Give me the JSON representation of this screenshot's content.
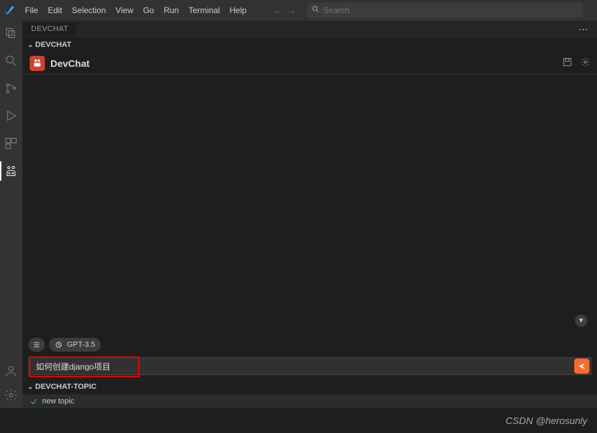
{
  "menu": {
    "items": [
      "File",
      "Edit",
      "Selection",
      "View",
      "Go",
      "Run",
      "Terminal",
      "Help"
    ]
  },
  "search": {
    "placeholder": "Search"
  },
  "tabs": {
    "active": "DEVCHAT"
  },
  "sections": {
    "devchat": {
      "label": "DEVCHAT",
      "title": "DevChat"
    },
    "topic": {
      "label": "DEVCHAT-TOPIC"
    }
  },
  "model_pill": {
    "label": "GPT-3.5"
  },
  "input": {
    "value": "如何创建django项目"
  },
  "topics": [
    {
      "label": "new topic"
    }
  ],
  "watermark": "CSDN @herosunly"
}
